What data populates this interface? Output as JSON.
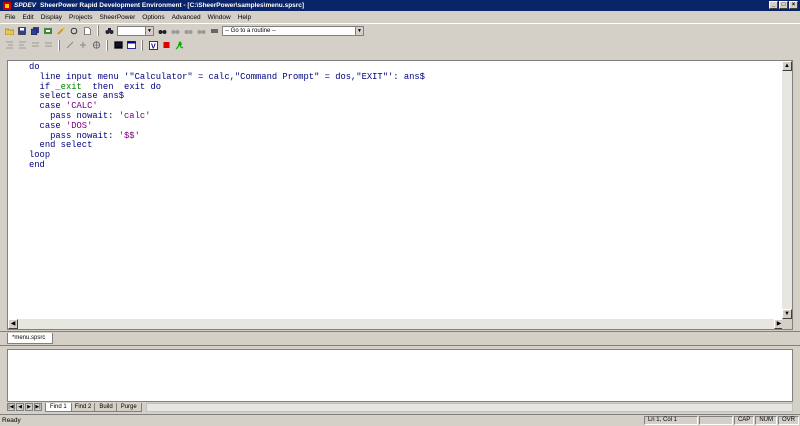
{
  "window": {
    "app_short": "SPDEV",
    "title": "SheerPower Rapid Development Environment - [C:\\SheerPower\\samples\\menu.spsrc]"
  },
  "menu": [
    "File",
    "Edit",
    "Display",
    "Projects",
    "SheerPower",
    "Options",
    "Advanced",
    "Window",
    "Help"
  ],
  "toolbar": {
    "goto_routine_placeholder": "-- Go to a routine --"
  },
  "editor": {
    "lines": [
      {
        "segs": [
          {
            "t": "do",
            "c": "code"
          }
        ]
      },
      {
        "segs": [
          {
            "t": "  line input menu '",
            "c": "code"
          },
          {
            "t": "\"Calculator\" = calc,\"Command Prompt\" = dos,\"EXIT\"",
            "c": "code"
          },
          {
            "t": "': ans$",
            "c": "code"
          }
        ]
      },
      {
        "segs": [
          {
            "t": "  if ",
            "c": "code"
          },
          {
            "t": "_exit",
            "c": "kw"
          },
          {
            "t": "  then  exit do",
            "c": "code"
          }
        ]
      },
      {
        "segs": [
          {
            "t": "  select case ans$",
            "c": "code"
          }
        ]
      },
      {
        "segs": [
          {
            "t": "  case ",
            "c": "code"
          },
          {
            "t": "'CALC'",
            "c": "lit"
          }
        ]
      },
      {
        "segs": [
          {
            "t": "    pass nowait: ",
            "c": "code"
          },
          {
            "t": "'calc'",
            "c": "lit"
          }
        ]
      },
      {
        "segs": [
          {
            "t": "  case ",
            "c": "code"
          },
          {
            "t": "'DOS'",
            "c": "lit"
          }
        ]
      },
      {
        "segs": [
          {
            "t": "    pass nowait: ",
            "c": "code"
          },
          {
            "t": "'$$'",
            "c": "lit"
          }
        ]
      },
      {
        "segs": [
          {
            "t": "  end select",
            "c": "code"
          }
        ]
      },
      {
        "segs": [
          {
            "t": "loop",
            "c": "code"
          }
        ]
      },
      {
        "segs": [
          {
            "t": "end",
            "c": "code"
          }
        ]
      }
    ]
  },
  "doc_tab": "*menu.spsrc",
  "output_tabs": [
    "Find 1",
    "Find 2",
    "Build",
    "Purge"
  ],
  "status": {
    "message": "Ready",
    "position": "Ln 1, Col 1",
    "indicators": [
      "CAP",
      "NUM",
      "OVR"
    ]
  },
  "colors": {
    "code": "#000080",
    "literal": "#800080",
    "keyword": "#008000",
    "titlebar": "#0a246a"
  }
}
